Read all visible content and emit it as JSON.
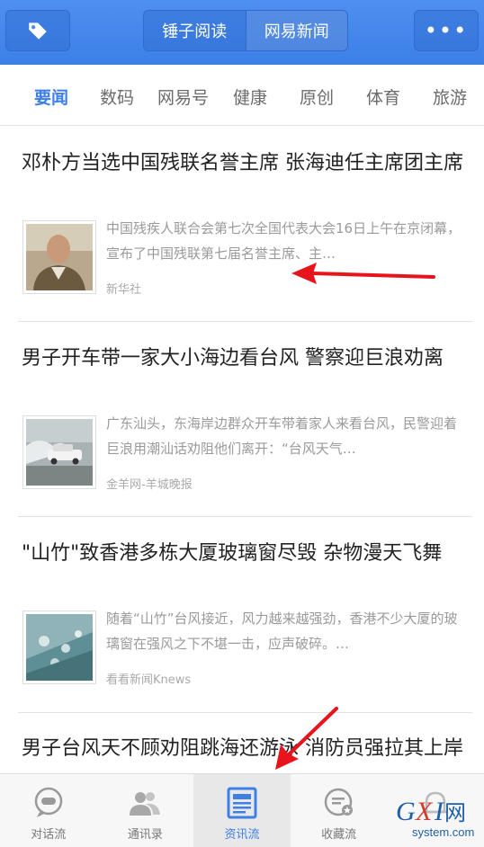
{
  "header": {
    "tag_icon": "tag-icon",
    "segments": [
      "锤子阅读",
      "网易新闻"
    ],
    "active_segment": 1,
    "more_label": "•••"
  },
  "tabs": [
    "要闻",
    "数码",
    "网易号",
    "健康",
    "原创",
    "体育",
    "旅游"
  ],
  "articles": [
    {
      "title": "邓朴方当选中国残联名誉主席 张海迪任主席团主席",
      "summary": "中国残疾人联合会第七次全国代表大会16日上午在京闭幕，宣布了中国残联第七届名誉主席、主…",
      "source": "新华社"
    },
    {
      "title": "男子开车带一家大小海边看台风 警察迎巨浪劝离",
      "summary": "广东汕头，东海岸边群众开车带着家人来看台风，民警迎着巨浪用潮汕话劝阻他们离开：“台风天气…",
      "source": "金羊网-羊城晚报"
    },
    {
      "title": "\"山竹\"致香港多栋大厦玻璃窗尽毁 杂物漫天飞舞",
      "summary": "随着“山竹”台风接近，风力越来越强劲，香港不少大厦的玻璃窗在强风之下不堪一击，应声破碎。…",
      "source": "看看新闻Knews"
    },
    {
      "title": "男子台风天不顾劝阻跳海还游泳 消防员强拉其上岸"
    }
  ],
  "bottom_nav": [
    {
      "label": "对话流",
      "icon": "chat-flow-icon"
    },
    {
      "label": "通讯录",
      "icon": "contacts-icon"
    },
    {
      "label": "资讯流",
      "icon": "news-feed-icon"
    },
    {
      "label": "收藏流",
      "icon": "favorites-icon"
    },
    {
      "label": "",
      "icon": "notification-bell-icon"
    }
  ],
  "active_nav": 2,
  "watermark": {
    "brand": "GXI网",
    "domain": "system.com"
  },
  "colors": {
    "header": "#3c7fe6",
    "accent": "#3c7fe6",
    "arrow": "#e8141c"
  }
}
